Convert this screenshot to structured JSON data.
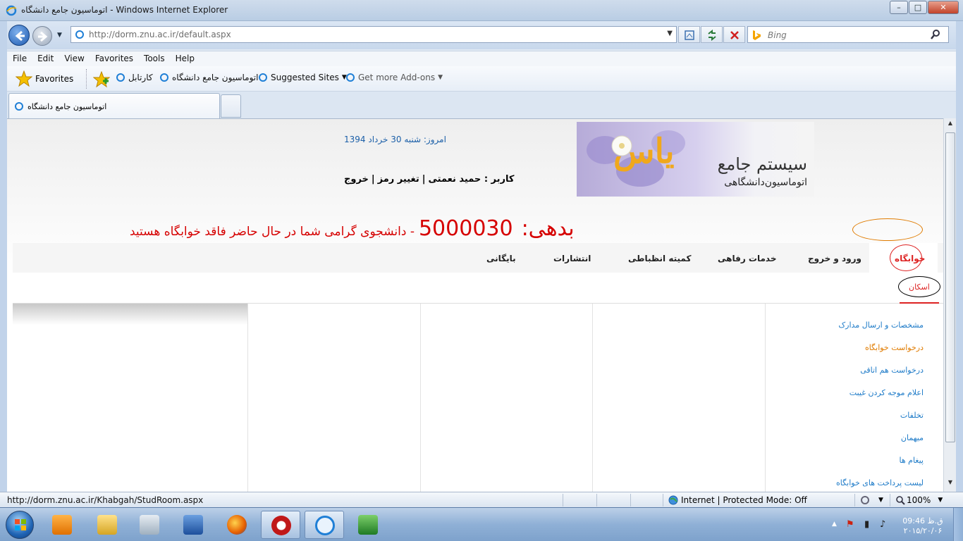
{
  "window": {
    "title": "اتوماسیون جامع دانشگاه - Windows Internet Explorer",
    "min_label": "–",
    "max_label": "□",
    "close_label": "✕"
  },
  "navbar": {
    "url": "http://dorm.znu.ac.ir/default.aspx",
    "search_placeholder": "Bing"
  },
  "menu": [
    "File",
    "Edit",
    "View",
    "Favorites",
    "Tools",
    "Help"
  ],
  "favorites": {
    "label": "Favorites",
    "items": [
      {
        "label": "کارتابل"
      },
      {
        "label": "اتوماسیون جامع دانشگاه"
      },
      {
        "label": "Suggested Sites"
      },
      {
        "label": "Get more Add-ons"
      }
    ]
  },
  "tab": {
    "title": "اتوماسیون جامع دانشگاه"
  },
  "page": {
    "date_text": "امروز: شنبه 30 خرداد 1394",
    "banner_title": "سیستم جامع",
    "banner_subtitle": "اتوماسیون‌دانشگاهی",
    "banner_logo": "یاس",
    "user_label": "کاربر : حمید نعمتی",
    "change_password": "تغییر رمز",
    "logout": "خروج",
    "separator": "|",
    "debt_label": "بدهی:",
    "debt_value": "5000030",
    "debt_message": "- دانشجوی گرامی شما در حال حاضر فاقد خوابگاه هستید",
    "main_menu": [
      {
        "label": "خوابگاه",
        "active": true
      },
      {
        "label": "ورود و خروج"
      },
      {
        "label": "خدمات رفاهی"
      },
      {
        "label": "کمیته انظباطی"
      },
      {
        "label": "انتشارات"
      },
      {
        "label": "بایگانی"
      }
    ],
    "sub_menu_active": "اسکان",
    "side_links": [
      {
        "label": "مشخصات و ارسال مدارک"
      },
      {
        "label": "درخواست خوابگاه",
        "highlight": true
      },
      {
        "label": "درخواست هم اتاقی"
      },
      {
        "label": "اعلام موجه کردن غیبت"
      },
      {
        "label": "تخلفات"
      },
      {
        "label": "میهمان"
      },
      {
        "label": "پیغام ها"
      },
      {
        "label": "لیست پرداخت های خوابگاه"
      }
    ]
  },
  "statusbar": {
    "url": "http://dorm.znu.ac.ir/Khabgah/StudRoom.aspx",
    "zone": "Internet | Protected Mode: Off",
    "zoom": "100%"
  },
  "taskbar": {
    "time": "09:46 ق.ظ",
    "date": "۲۰۱۵/۲۰/۰۶"
  },
  "colors": {
    "debt_red": "#d60000",
    "link_blue": "#1e7bc8",
    "highlight_orange": "#e07b00"
  }
}
